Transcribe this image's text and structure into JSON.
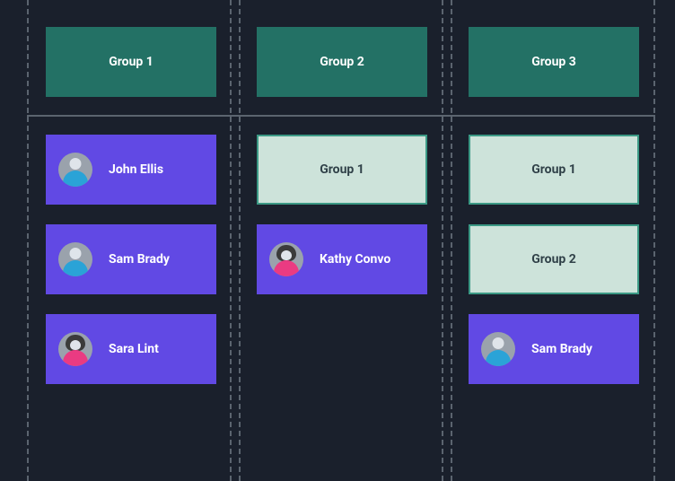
{
  "headers": [
    "Group 1",
    "Group 2",
    "Group 3"
  ],
  "columns": [
    [
      {
        "kind": "person",
        "name": "John Ellis",
        "avatar": "male"
      },
      {
        "kind": "person",
        "name": "Sam Brady",
        "avatar": "male"
      },
      {
        "kind": "person",
        "name": "Sara Lint",
        "avatar": "female"
      }
    ],
    [
      {
        "kind": "group",
        "name": "Group 1"
      },
      {
        "kind": "person",
        "name": "Kathy Convo",
        "avatar": "female"
      }
    ],
    [
      {
        "kind": "group",
        "name": "Group 1"
      },
      {
        "kind": "group",
        "name": "Group 2"
      },
      {
        "kind": "person",
        "name": "Sam Brady",
        "avatar": "male"
      }
    ]
  ]
}
